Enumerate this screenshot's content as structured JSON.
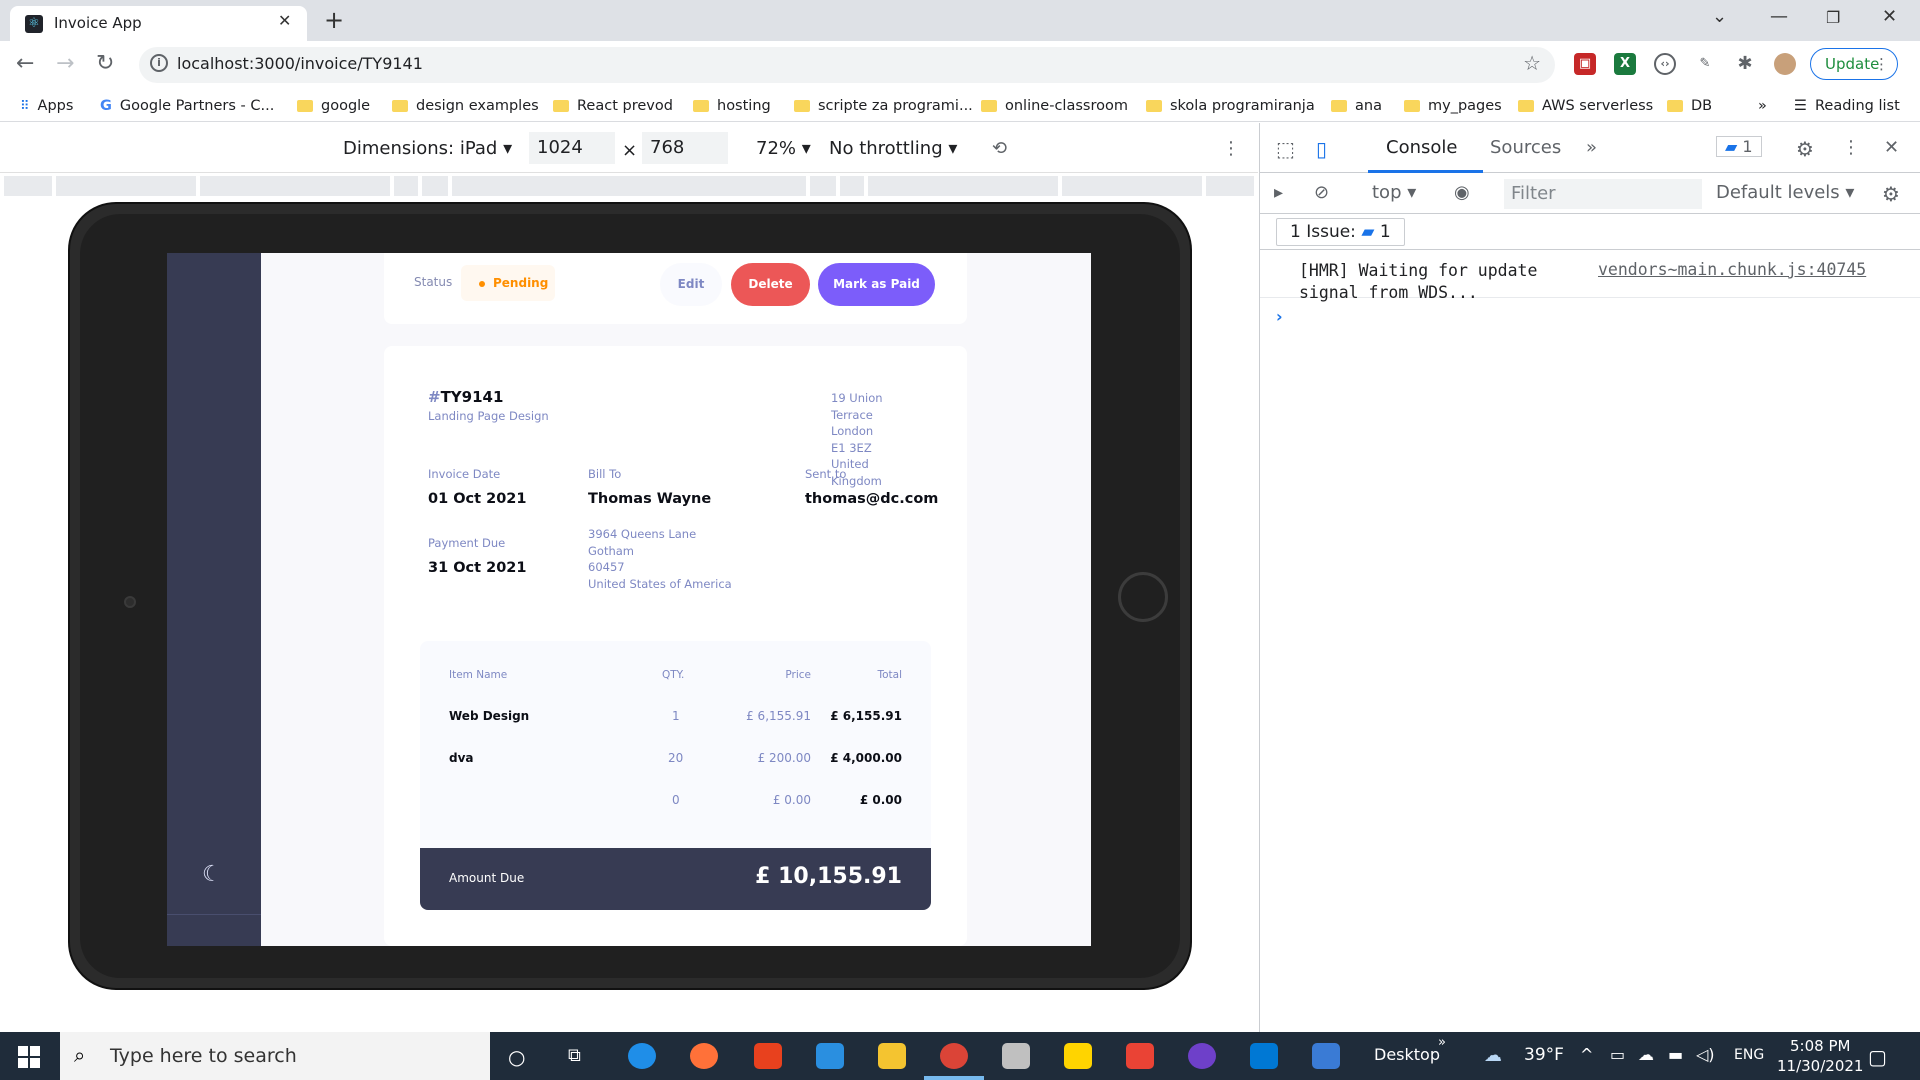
{
  "browser": {
    "tab_title": "Invoice App",
    "url": "localhost:3000/invoice/TY9141",
    "update_label": "Update",
    "bookmarks": [
      "Apps",
      "Google Partners - C...",
      "google",
      "design examples",
      "React prevod",
      "hosting",
      "scripte za programi...",
      "online-classroom",
      "skola programiranja",
      "ana",
      "my_pages",
      "AWS serverless",
      "DB"
    ],
    "reading_list": "Reading list",
    "more": "»"
  },
  "device_toolbar": {
    "dimensions_label": "Dimensions: iPad",
    "width": "1024",
    "times": "×",
    "height": "768",
    "zoom": "72%",
    "throttling": "No throttling"
  },
  "invoice": {
    "status_label": "Status",
    "status": "Pending",
    "edit_label": "Edit",
    "delete_label": "Delete",
    "mark_paid_label": "Mark as Paid",
    "hash": "#",
    "id": "TY9141",
    "description": "Landing Page Design",
    "sender_address": [
      "19 Union Terrace",
      "London",
      "E1 3EZ",
      "United Kingdom"
    ],
    "invoice_date_label": "Invoice Date",
    "invoice_date": "01 Oct 2021",
    "payment_due_label": "Payment Due",
    "payment_due": "31 Oct 2021",
    "bill_to_label": "Bill To",
    "client_name": "Thomas Wayne",
    "client_address": [
      "3964 Queens Lane",
      "Gotham",
      "60457",
      "United States of America"
    ],
    "sent_to_label": "Sent to",
    "client_email": "thomas@dc.com",
    "table_headers": {
      "name": "Item Name",
      "qty": "QTY.",
      "price": "Price",
      "total": "Total"
    },
    "items": [
      {
        "name": "Web Design",
        "qty": "1",
        "price": "£ 6,155.91",
        "total": "£ 6,155.91"
      },
      {
        "name": "dva",
        "qty": "20",
        "price": "£ 200.00",
        "total": "£ 4,000.00"
      },
      {
        "name": "",
        "qty": "0",
        "price": "£ 0.00",
        "total": "£ 0.00"
      }
    ],
    "amount_due_label": "Amount Due",
    "amount_due": "£ 10,155.91"
  },
  "devtools": {
    "tabs": [
      "Console",
      "Sources"
    ],
    "more_tabs": "»",
    "message_count": "1",
    "context": "top",
    "filter_placeholder": "Filter",
    "levels": "Default levels",
    "issue_label": "1 Issue:",
    "issue_count": "1",
    "log_message": "[HMR] Waiting for update signal from WDS...",
    "log_source": "vendors~main.chunk.js:40745",
    "prompt": "›"
  },
  "taskbar": {
    "search_placeholder": "Type here to search",
    "desktop_label": "Desktop",
    "temperature": "39°F",
    "language": "ENG",
    "time": "5:08 PM",
    "date": "11/30/2021"
  }
}
